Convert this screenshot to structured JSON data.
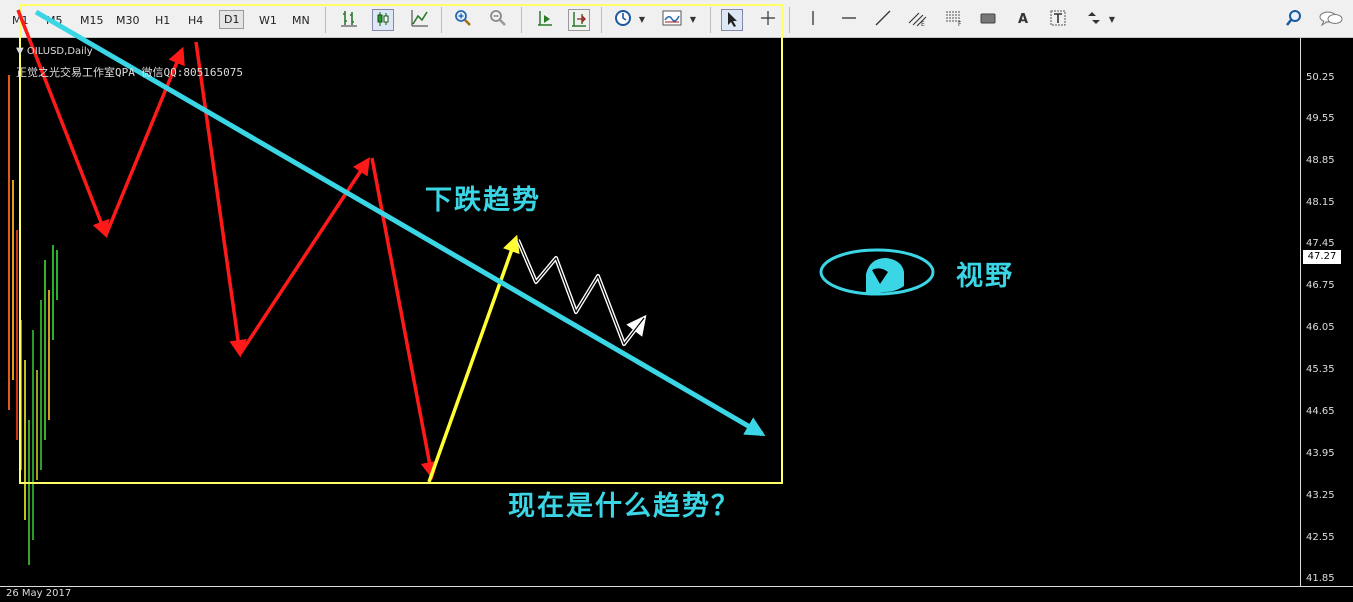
{
  "toolbar": {
    "timeframes": [
      "M1",
      "M5",
      "M15",
      "M30",
      "H1",
      "H4",
      "D1",
      "W1",
      "MN"
    ],
    "active_timeframe": "D1",
    "text_tool_label": "A"
  },
  "chart": {
    "symbol": "OILUSD,Daily",
    "info_text": "正觉之光交易工作室QPA 微信QQ:805165075",
    "date_label": "26 May 2017",
    "current_price": "47.27",
    "price_labels": [
      "50.25",
      "49.55",
      "48.85",
      "48.15",
      "47.45",
      "46.75",
      "46.05",
      "45.35",
      "44.65",
      "43.95",
      "43.25",
      "42.55",
      "41.85"
    ]
  },
  "annotations": {
    "downtrend_label": "下跌趋势",
    "question_label": "现在是什么趋势？",
    "vision_label": "视野"
  },
  "colors": {
    "background": "#000000",
    "trendline": "#3bd6e6",
    "zigzag": "#ff1a1a",
    "rebound": "#ffff33",
    "box": "#ffff66",
    "small_zigzag": "#ffffff",
    "text": "#3bd6e6"
  }
}
